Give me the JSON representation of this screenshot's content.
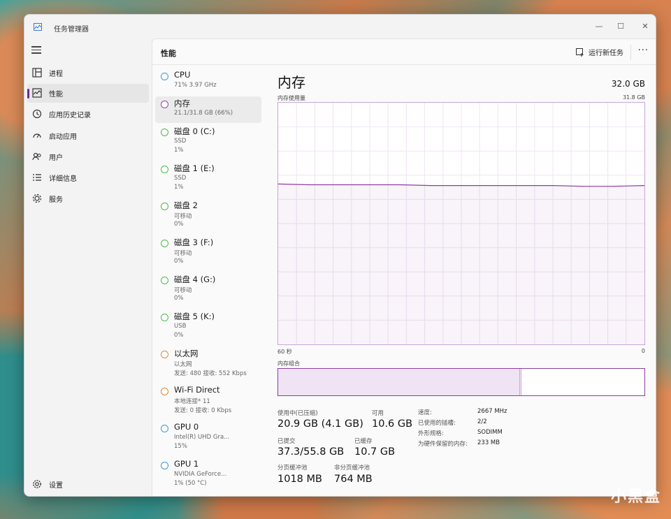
{
  "window": {
    "title": "任务管理器",
    "controls": {
      "minimize": "—",
      "maximize": "☐",
      "close": "✕"
    }
  },
  "sidebar": {
    "menu_icon": "hamburger-icon",
    "items": [
      {
        "label": "进程",
        "icon": "processes-icon"
      },
      {
        "label": "性能",
        "icon": "performance-icon",
        "active": true
      },
      {
        "label": "应用历史记录",
        "icon": "app-history-icon"
      },
      {
        "label": "启动应用",
        "icon": "startup-icon"
      },
      {
        "label": "用户",
        "icon": "users-icon"
      },
      {
        "label": "详细信息",
        "icon": "details-icon"
      },
      {
        "label": "服务",
        "icon": "services-icon"
      }
    ],
    "settings_label": "设置"
  },
  "header": {
    "title": "性能",
    "run_task_label": "运行新任务",
    "more_label": "···"
  },
  "devices": [
    {
      "name": "CPU",
      "sub1": "71% 3.97 GHz",
      "sub2": "",
      "sub3": "",
      "color": "#3a9ad9"
    },
    {
      "name": "内存",
      "sub1": "21.1/31.8 GB (66%)",
      "sub2": "",
      "sub3": "",
      "color": "#9b3fb5",
      "active": true
    },
    {
      "name": "磁盘 0 (C:)",
      "sub1": "SSD",
      "sub2": "1%",
      "sub3": "",
      "color": "#4cb94c"
    },
    {
      "name": "磁盘 1 (E:)",
      "sub1": "SSD",
      "sub2": "1%",
      "sub3": "",
      "color": "#4cb94c"
    },
    {
      "name": "磁盘 2",
      "sub1": "可移动",
      "sub2": "0%",
      "sub3": "",
      "color": "#4cb94c"
    },
    {
      "name": "磁盘 3 (F:)",
      "sub1": "可移动",
      "sub2": "0%",
      "sub3": "",
      "color": "#4cb94c"
    },
    {
      "name": "磁盘 4 (G:)",
      "sub1": "可移动",
      "sub2": "0%",
      "sub3": "",
      "color": "#4cb94c"
    },
    {
      "name": "磁盘 5 (K:)",
      "sub1": "USB",
      "sub2": "0%",
      "sub3": "",
      "color": "#4cb94c"
    },
    {
      "name": "以太网",
      "sub1": "以太网",
      "sub2": "发送: 480 接收: 552 Kbps",
      "sub3": "",
      "color": "#d98a3a"
    },
    {
      "name": "Wi-Fi Direct",
      "sub1": "本地连接* 11",
      "sub2": "发送: 0 接收: 0 Kbps",
      "sub3": "",
      "color": "#d98a3a"
    },
    {
      "name": "GPU 0",
      "sub1": "Intel(R) UHD Gra...",
      "sub2": "15%",
      "sub3": "",
      "color": "#3a9ad9"
    },
    {
      "name": "GPU 1",
      "sub1": "NVIDIA GeForce...",
      "sub2": "1% (50 °C)",
      "sub3": "",
      "color": "#3a9ad9"
    }
  ],
  "detail": {
    "title": "内存",
    "total": "32.0 GB",
    "graph_label": "内存使用量",
    "graph_max": "31.8 GB",
    "axis_left": "60 秒",
    "axis_right": "0",
    "composition_label": "内存组合",
    "composition_used_fraction": 0.66,
    "composition_modified_fraction": 0.005,
    "stats": {
      "in_use_label": "使用中(已压缩)",
      "in_use_value": "20.9 GB (4.1 GB)",
      "available_label": "可用",
      "available_value": "10.6 GB",
      "committed_label": "已提交",
      "committed_value": "37.3/55.8 GB",
      "cached_label": "已缓存",
      "cached_value": "10.7 GB",
      "paged_label": "分页缓冲池",
      "paged_value": "1018 MB",
      "nonpaged_label": "非分页缓冲池",
      "nonpaged_value": "764 MB"
    },
    "props": [
      {
        "key": "速度:",
        "val": "2667 MHz"
      },
      {
        "key": "已使用的插槽:",
        "val": "2/2"
      },
      {
        "key": "外形规格:",
        "val": "SODIMM"
      },
      {
        "key": "为硬件保留的内存:",
        "val": "233 MB"
      }
    ]
  },
  "chart_data": {
    "type": "line",
    "title": "内存使用量",
    "xlabel": "",
    "ylabel": "",
    "x": [
      60,
      55,
      50,
      45,
      40,
      35,
      30,
      25,
      20,
      15,
      10,
      5,
      0
    ],
    "series": [
      {
        "values": [
          21.1,
          21.0,
          21.0,
          21.0,
          21.0,
          20.9,
          20.9,
          20.9,
          20.9,
          20.9,
          20.8,
          20.8,
          20.9
        ]
      }
    ],
    "xlim": [
      60,
      0
    ],
    "ylim": [
      0,
      31.8
    ],
    "grid": true,
    "color": "#8b3ea0"
  },
  "watermark": "小黑盒"
}
